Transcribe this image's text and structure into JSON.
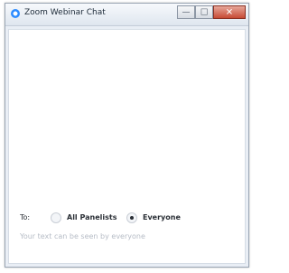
{
  "window": {
    "title": "Zoom Webinar Chat"
  },
  "controls": {
    "minimize_icon": "minimize-icon",
    "maximize_icon": "maximize-icon",
    "close_icon": "close-icon",
    "close_color": "#c74a34"
  },
  "chat": {
    "to_label": "To:",
    "options": [
      {
        "label": "All Panelists",
        "selected": false
      },
      {
        "label": "Everyone",
        "selected": true
      }
    ],
    "input": {
      "placeholder": "Your text can be seen by everyone",
      "value": ""
    }
  }
}
